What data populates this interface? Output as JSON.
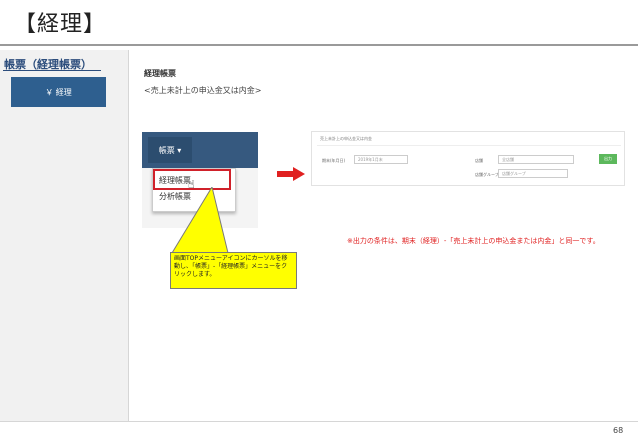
{
  "title": "【経理】",
  "sidebar": {
    "heading": "帳票（経理帳票）",
    "button_label": "￥ 経理"
  },
  "content": {
    "heading": "経理帳票",
    "subheading": "<売上未計上の申込金又は内金>"
  },
  "screenshot_left": {
    "nav_button_label": "帳票 ▾",
    "menu_items": [
      "経理帳票",
      "分析帳票"
    ]
  },
  "screenshot_right": {
    "title": "売上未計上の申込金又は内金",
    "field1_label": "期末(年月日)",
    "field1_value": "2019年1月末",
    "field2_label": "店舗",
    "field2_value": "全店舗",
    "field3_label": "店舗グループ",
    "field3_value": "店舗グループ",
    "button_label": "出力"
  },
  "note": "※出力の条件は、期末（経理）-「売上未計上の申込金または内金」と同一です。",
  "callout": "画面TOPメニューアイコンにカーソルを移動し、「帳票」-「経理帳票」メニューをクリックします。",
  "page_number": "68",
  "colors": {
    "sidebar_button": "#2e5f8f",
    "nav_bar": "#36597f",
    "highlight": "#d0212a",
    "arrow": "#e02020",
    "callout": "#ffff00",
    "note": "#e02020",
    "output_button": "#5cb85c"
  }
}
